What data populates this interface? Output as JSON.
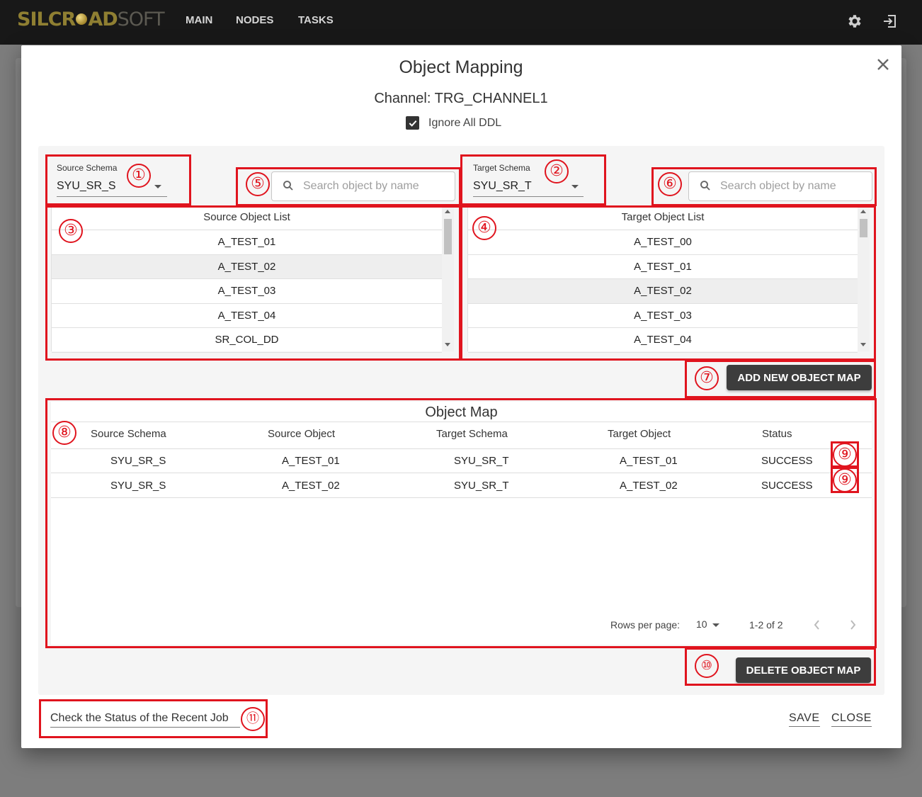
{
  "appbar": {
    "logo": {
      "part1": "SILCR",
      "part2": "AD",
      "part3": "SOFT"
    },
    "nav": [
      "MAIN",
      "NODES",
      "TASKS"
    ]
  },
  "modal": {
    "title": "Object Mapping",
    "channel": "Channel: TRG_CHANNEL1",
    "ignore_ddl_label": "Ignore All DDL",
    "ignore_ddl_checked": true
  },
  "source": {
    "schema_label": "Source Schema",
    "schema_value": "SYU_SR_S",
    "search_placeholder": "Search object by name",
    "list_header": "Source Object List",
    "items": [
      "A_TEST_01",
      "A_TEST_02",
      "A_TEST_03",
      "A_TEST_04",
      "SR_COL_DD"
    ],
    "selected_index": 1
  },
  "target": {
    "schema_label": "Target Schema",
    "schema_value": "SYU_SR_T",
    "search_placeholder": "Search object by name",
    "list_header": "Target Object List",
    "items": [
      "A_TEST_00",
      "A_TEST_01",
      "A_TEST_02",
      "A_TEST_03",
      "A_TEST_04"
    ],
    "selected_index": 2
  },
  "buttons": {
    "add_map": "ADD NEW OBJECT MAP",
    "delete_map": "DELETE OBJECT MAP",
    "save": "SAVE",
    "close": "CLOSE"
  },
  "object_map": {
    "title": "Object Map",
    "columns": [
      "Source Schema",
      "Source Object",
      "Target Schema",
      "Target Object",
      "Status"
    ],
    "rows": [
      [
        "SYU_SR_S",
        "A_TEST_01",
        "SYU_SR_T",
        "A_TEST_01",
        "SUCCESS"
      ],
      [
        "SYU_SR_S",
        "A_TEST_02",
        "SYU_SR_T",
        "A_TEST_02",
        "SUCCESS"
      ]
    ],
    "rows_per_page_label": "Rows per page:",
    "rows_per_page": "10",
    "range": "1-2 of 2"
  },
  "footer": {
    "recent_job_link": "Check the Status of the Recent Job"
  },
  "annotations": [
    "①",
    "②",
    "③",
    "④",
    "⑤",
    "⑥",
    "⑦",
    "⑧",
    "⑨",
    "⑨",
    "⑩",
    "⑪"
  ],
  "colors": {
    "annotation": "#e0141e",
    "dark_button": "#3d3d3d",
    "appbar": "#181818"
  }
}
